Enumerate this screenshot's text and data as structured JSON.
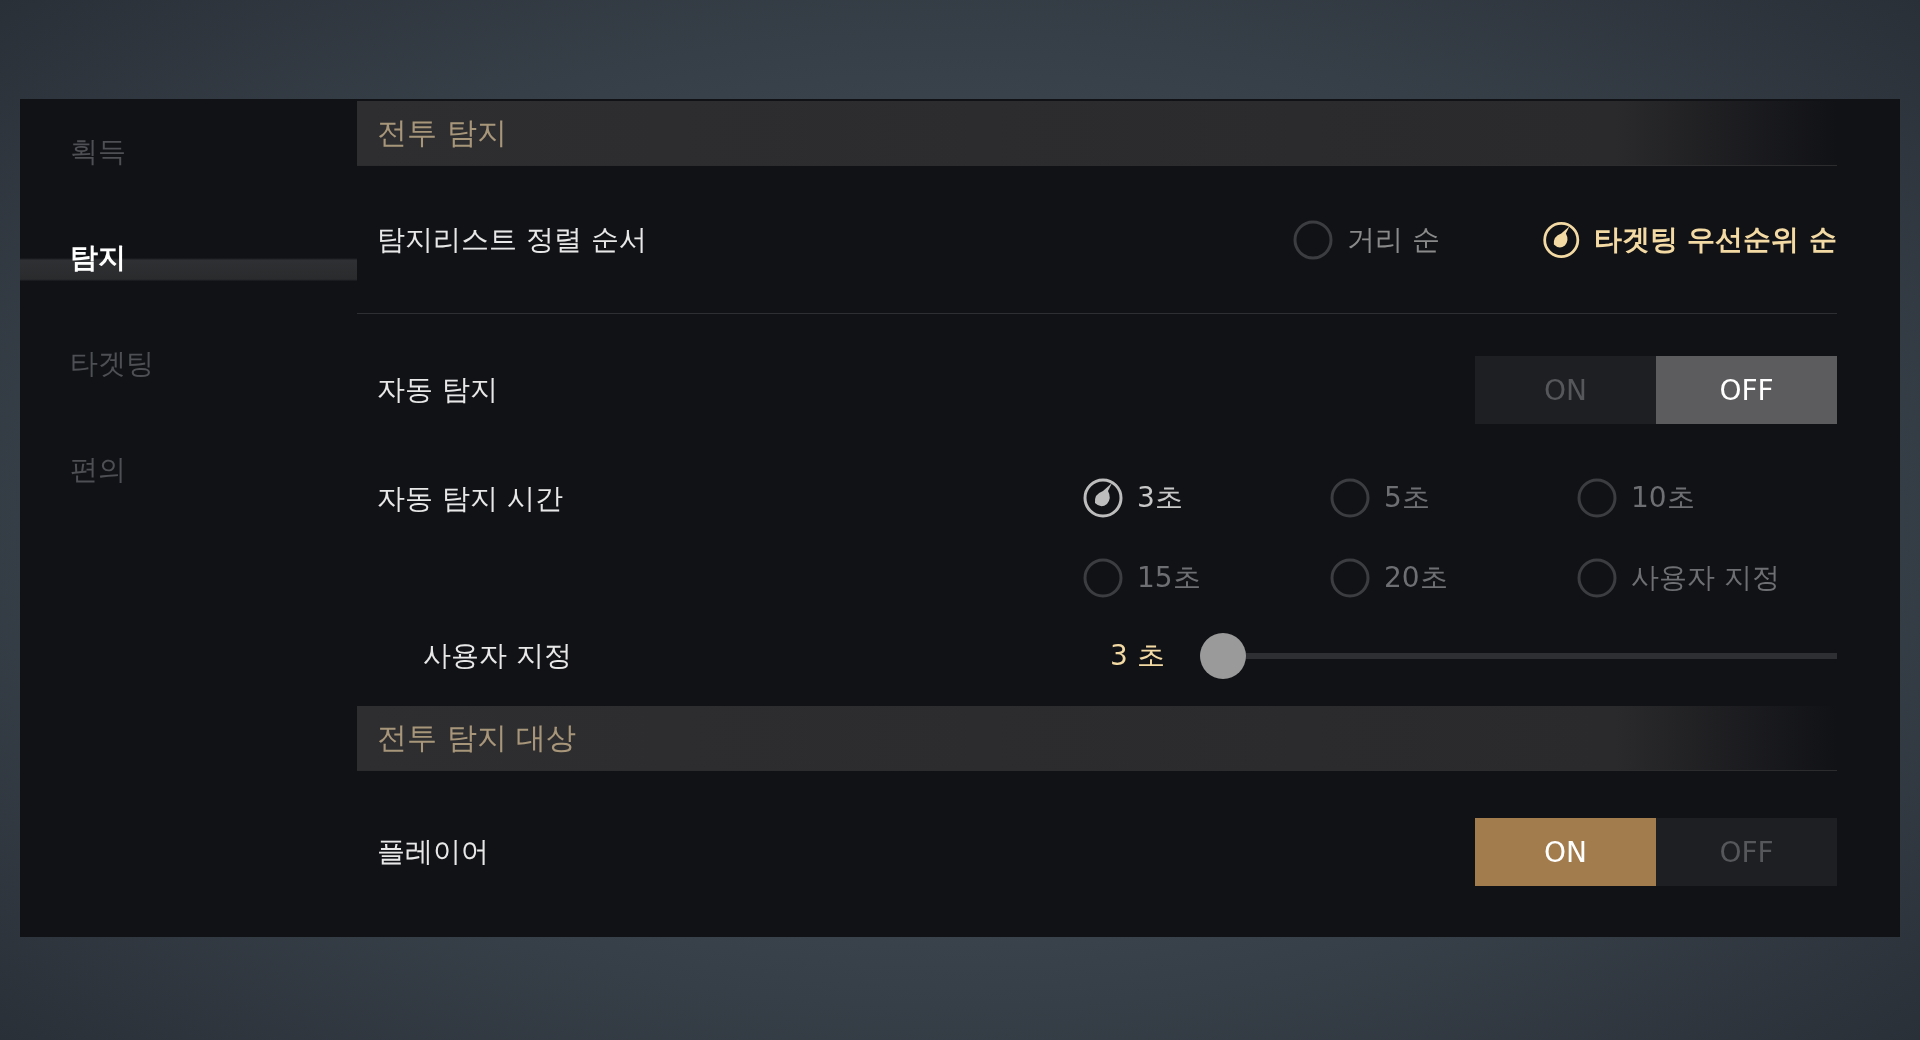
{
  "sidebar": {
    "items": [
      {
        "label": "획득",
        "selected": false
      },
      {
        "label": "탐지",
        "selected": true
      },
      {
        "label": "타겟팅",
        "selected": false
      },
      {
        "label": "편의",
        "selected": false
      }
    ]
  },
  "sections": [
    {
      "title": "전투 탐지",
      "rows": [
        {
          "kind": "radio",
          "label": "탐지리스트 정렬 순서",
          "options": [
            {
              "label": "거리 순",
              "selected": false
            },
            {
              "label": "타겟팅 우선순위 순",
              "selected": true
            }
          ]
        },
        {
          "kind": "toggle",
          "label": "자동 탐지",
          "options": [
            {
              "label": "ON",
              "selected": false
            },
            {
              "label": "OFF",
              "selected": true
            }
          ]
        },
        {
          "kind": "radio-grid",
          "label": "자동 탐지 시간",
          "options": [
            {
              "label": "3초",
              "selected": true
            },
            {
              "label": "5초",
              "selected": false
            },
            {
              "label": "10초",
              "selected": false
            },
            {
              "label": "15초",
              "selected": false
            },
            {
              "label": "20초",
              "selected": false
            },
            {
              "label": "사용자 지정",
              "selected": false
            }
          ]
        },
        {
          "kind": "slider",
          "label": "사용자 지정",
          "reading": "3 초",
          "level": 0
        }
      ]
    },
    {
      "title": "전투 탐지 대상",
      "rows": [
        {
          "kind": "toggle",
          "label": "플레이어",
          "options": [
            {
              "label": "ON",
              "selected": true
            },
            {
              "label": "OFF",
              "selected": false
            }
          ]
        }
      ]
    }
  ]
}
